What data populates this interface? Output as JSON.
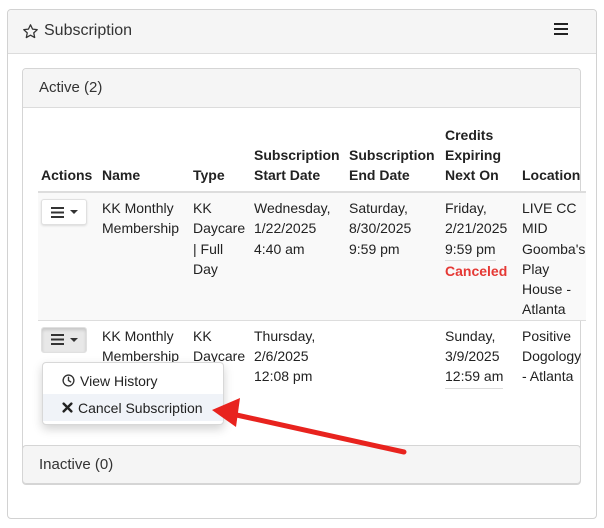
{
  "panel": {
    "title": "Subscription"
  },
  "active_section": {
    "header": "Active (2)"
  },
  "table": {
    "headers": {
      "actions": "Actions",
      "name": "Name",
      "type": "Type",
      "start": [
        "Subscription",
        "Start Date"
      ],
      "end": [
        "Subscription",
        "End Date"
      ],
      "credits": [
        "Credits",
        "Expiring",
        "Next On"
      ],
      "location": "Location"
    },
    "rows": [
      {
        "name": [
          "KK Monthly",
          "Membership"
        ],
        "type": [
          "KK",
          "Daycare",
          "| Full",
          "Day"
        ],
        "start": [
          "Wednesday,",
          "1/22/2025",
          "4:40 am"
        ],
        "end": [
          "Saturday,",
          "8/30/2025",
          "9:59 pm"
        ],
        "credits": [
          "Friday,",
          "2/21/2025",
          "9:59 pm"
        ],
        "status": "Canceled",
        "location": [
          "LIVE CC",
          "MID",
          "Goomba's",
          "Play",
          "House -",
          "Atlanta"
        ]
      },
      {
        "name": [
          "KK Monthly",
          "Membership"
        ],
        "type": [
          "KK",
          "Daycare"
        ],
        "start": [
          "Thursday,",
          "2/6/2025",
          "12:08 pm"
        ],
        "credits": [
          "Sunday,",
          "3/9/2025",
          "12:59 am"
        ],
        "location": [
          "Positive",
          "Dogology",
          "- Atlanta"
        ]
      }
    ]
  },
  "dropdown": {
    "view_history": "View History",
    "cancel_subscription": "Cancel Subscription"
  },
  "inactive_section": {
    "header": "Inactive (0)"
  },
  "colors": {
    "canceled": "#e53935",
    "arrow": "#e8231e"
  }
}
